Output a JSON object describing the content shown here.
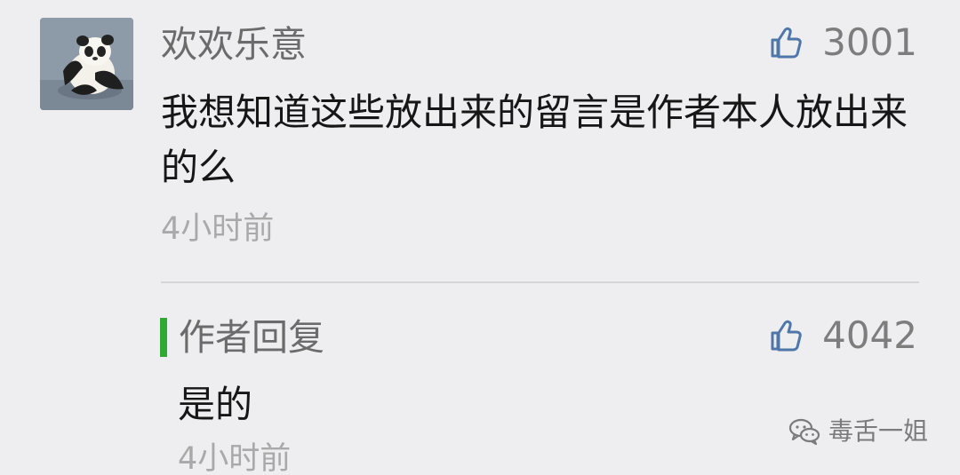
{
  "comment": {
    "username": "欢欢乐意",
    "likes": "3001",
    "text": "我想知道这些放出来的留言是作者本人放出来的么",
    "time": "4小时前",
    "avatar_icon": "panda-avatar"
  },
  "reply": {
    "label": "作者回复",
    "likes": "4042",
    "text": "是的",
    "time": "4小时前"
  },
  "watermark": {
    "text": "毒舌一姐",
    "icon": "wechat-icon"
  },
  "colors": {
    "background": "#eeeef0",
    "accent_bar": "#2fa934",
    "like_icon": "#4f76a8",
    "meta_text": "#a9a9a9"
  }
}
